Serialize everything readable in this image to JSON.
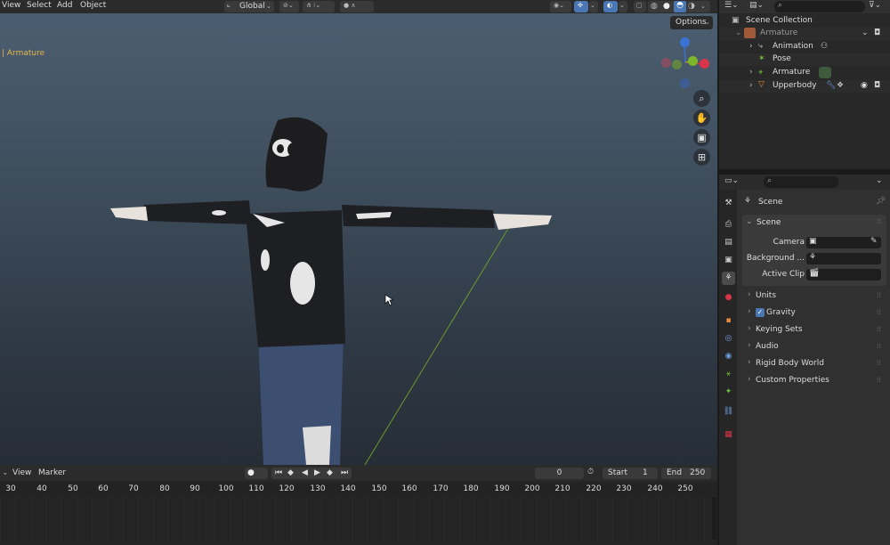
{
  "viewport": {
    "menus": [
      "View",
      "Select",
      "Add",
      "Object"
    ],
    "transform_orientation": "Global",
    "options_label": "Options",
    "object_label": "| Armature",
    "gizmo": {
      "x_color": "#d9354a",
      "y_color": "#7cb72a",
      "z_color": "#3a73d6"
    }
  },
  "timeline": {
    "menus": [
      "View",
      "Marker"
    ],
    "current_frame": "0",
    "start_label": "Start",
    "start_value": "1",
    "end_label": "End",
    "end_value": "250",
    "ruler_ticks": [
      "30",
      "40",
      "50",
      "60",
      "70",
      "80",
      "90",
      "100",
      "110",
      "120",
      "130",
      "140",
      "150",
      "160",
      "170",
      "180",
      "190",
      "200",
      "210",
      "220",
      "230",
      "240",
      "250"
    ]
  },
  "outliner": {
    "root": "Scene Collection",
    "items": [
      {
        "label": "Armature",
        "icon": "armature-object-icon"
      },
      {
        "label": "Animation",
        "icon": "animation-icon"
      },
      {
        "label": "Pose",
        "icon": "pose-icon"
      },
      {
        "label": "Armature",
        "icon": "armature-data-icon"
      },
      {
        "label": "Upperbody",
        "icon": "mesh-icon"
      }
    ]
  },
  "properties": {
    "context": "Scene",
    "panel_title": "Scene",
    "camera_label": "Camera",
    "background_label": "Background ...",
    "active_clip_label": "Active Clip",
    "sections": [
      {
        "label": "Units",
        "checkbox": false
      },
      {
        "label": "Gravity",
        "checkbox": true
      },
      {
        "label": "Keying Sets",
        "checkbox": false
      },
      {
        "label": "Audio",
        "checkbox": false
      },
      {
        "label": "Rigid Body World",
        "checkbox": false
      },
      {
        "label": "Custom Properties",
        "checkbox": false
      }
    ]
  },
  "colors": {
    "accent": "#4a77b4",
    "selected_text": "#e8b64a"
  }
}
